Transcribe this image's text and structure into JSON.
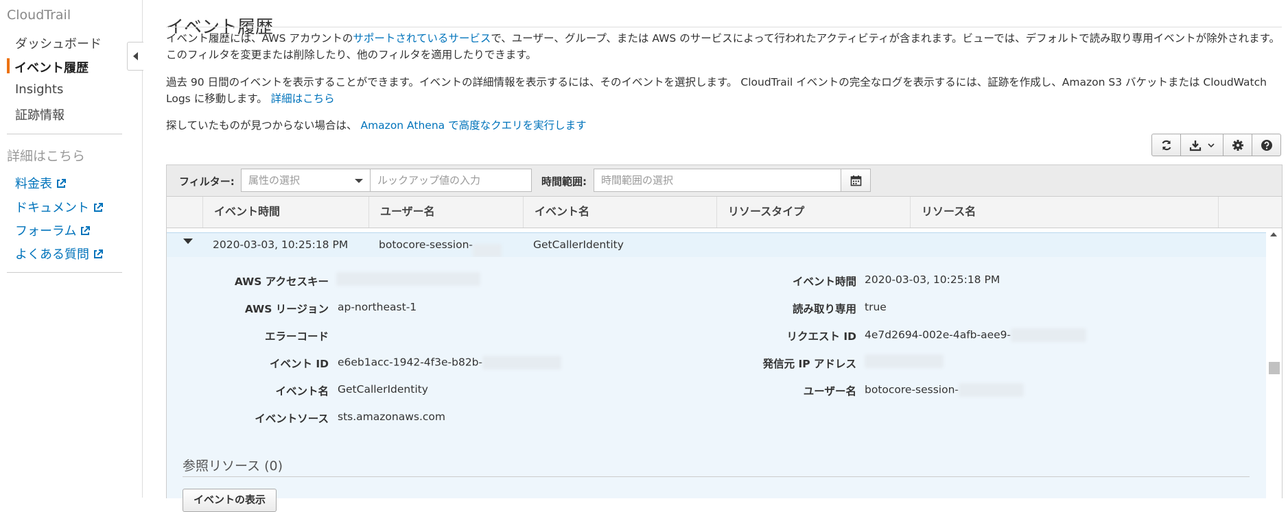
{
  "sidebar": {
    "brand": "CloudTrail",
    "nav": [
      {
        "label": "ダッシュボード",
        "active": false
      },
      {
        "label": "イベント履歴",
        "active": true
      },
      {
        "label": "Insights",
        "active": false
      },
      {
        "label": "証跡情報",
        "active": false
      }
    ],
    "more_heading": "詳細はこちら",
    "links": [
      "料金表",
      "ドキュメント",
      "フォーラム",
      "よくある質問"
    ]
  },
  "page": {
    "title": "イベント履歴",
    "intro_pre": "イベント履歴には、AWS アカウントの",
    "intro_link": "サポートされているサービス",
    "intro_post": "で、ユーザー、グループ、または AWS のサービスによって行われたアクティビティが含まれます。ビューでは、デフォルトで読み取り専用イベントが除外されます。このフィルタを変更または削除したり、他のフィルタを適用したりできます。",
    "info_text": "過去 90 日間のイベントを表示することができます。イベントの詳細情報を表示するには、そのイベントを選択します。 CloudTrail イベントの完全なログを表示するには、証跡を作成し、Amazon S3 バケットまたは CloudWatch Logs に移動します。",
    "info_link": "詳細はこちら",
    "athena_text": "探していたものが見つからない場合は、",
    "athena_link": "Amazon Athena で高度なクエリを実行します"
  },
  "filter": {
    "label": "フィルター:",
    "attribute_placeholder": "属性の選択",
    "lookup_placeholder": "ルックアップ値の入力",
    "time_label": "時間範囲:",
    "time_placeholder": "時間範囲の選択"
  },
  "columns": [
    "イベント時間",
    "ユーザー名",
    "イベント名",
    "リソースタイプ",
    "リソース名"
  ],
  "selected_row": {
    "time": "2020-03-03, 10:25:18 PM",
    "user": "botocore-session-",
    "event": "GetCallerIdentity"
  },
  "details": {
    "left": [
      {
        "label": "AWS アクセスキー",
        "value": ""
      },
      {
        "label": "AWS リージョン",
        "value": "ap-northeast-1"
      },
      {
        "label": "エラーコード",
        "value": ""
      },
      {
        "label": "イベント ID",
        "value": "e6eb1acc-1942-4f3e-b82b-"
      },
      {
        "label": "イベント名",
        "value": "GetCallerIdentity"
      },
      {
        "label": "イベントソース",
        "value": "sts.amazonaws.com"
      }
    ],
    "right": [
      {
        "label": "イベント時間",
        "value": "2020-03-03, 10:25:18 PM"
      },
      {
        "label": "読み取り専用",
        "value": "true"
      },
      {
        "label": "リクエスト ID",
        "value": "4e7d2694-002e-4afb-aee9-"
      },
      {
        "label": "発信元 IP アドレス",
        "value": ""
      },
      {
        "label": "ユーザー名",
        "value": "botocore-session-"
      }
    ],
    "ref_title": "参照リソース (0)",
    "show_events_label": "イベントの表示"
  },
  "colors": {
    "accent": "#ec7211",
    "link": "#0073bb",
    "selected_row": "#e7f3fb"
  },
  "icons": [
    "refresh-icon",
    "download-icon",
    "gear-icon",
    "help-icon",
    "calendar-icon",
    "external-link-icon"
  ]
}
